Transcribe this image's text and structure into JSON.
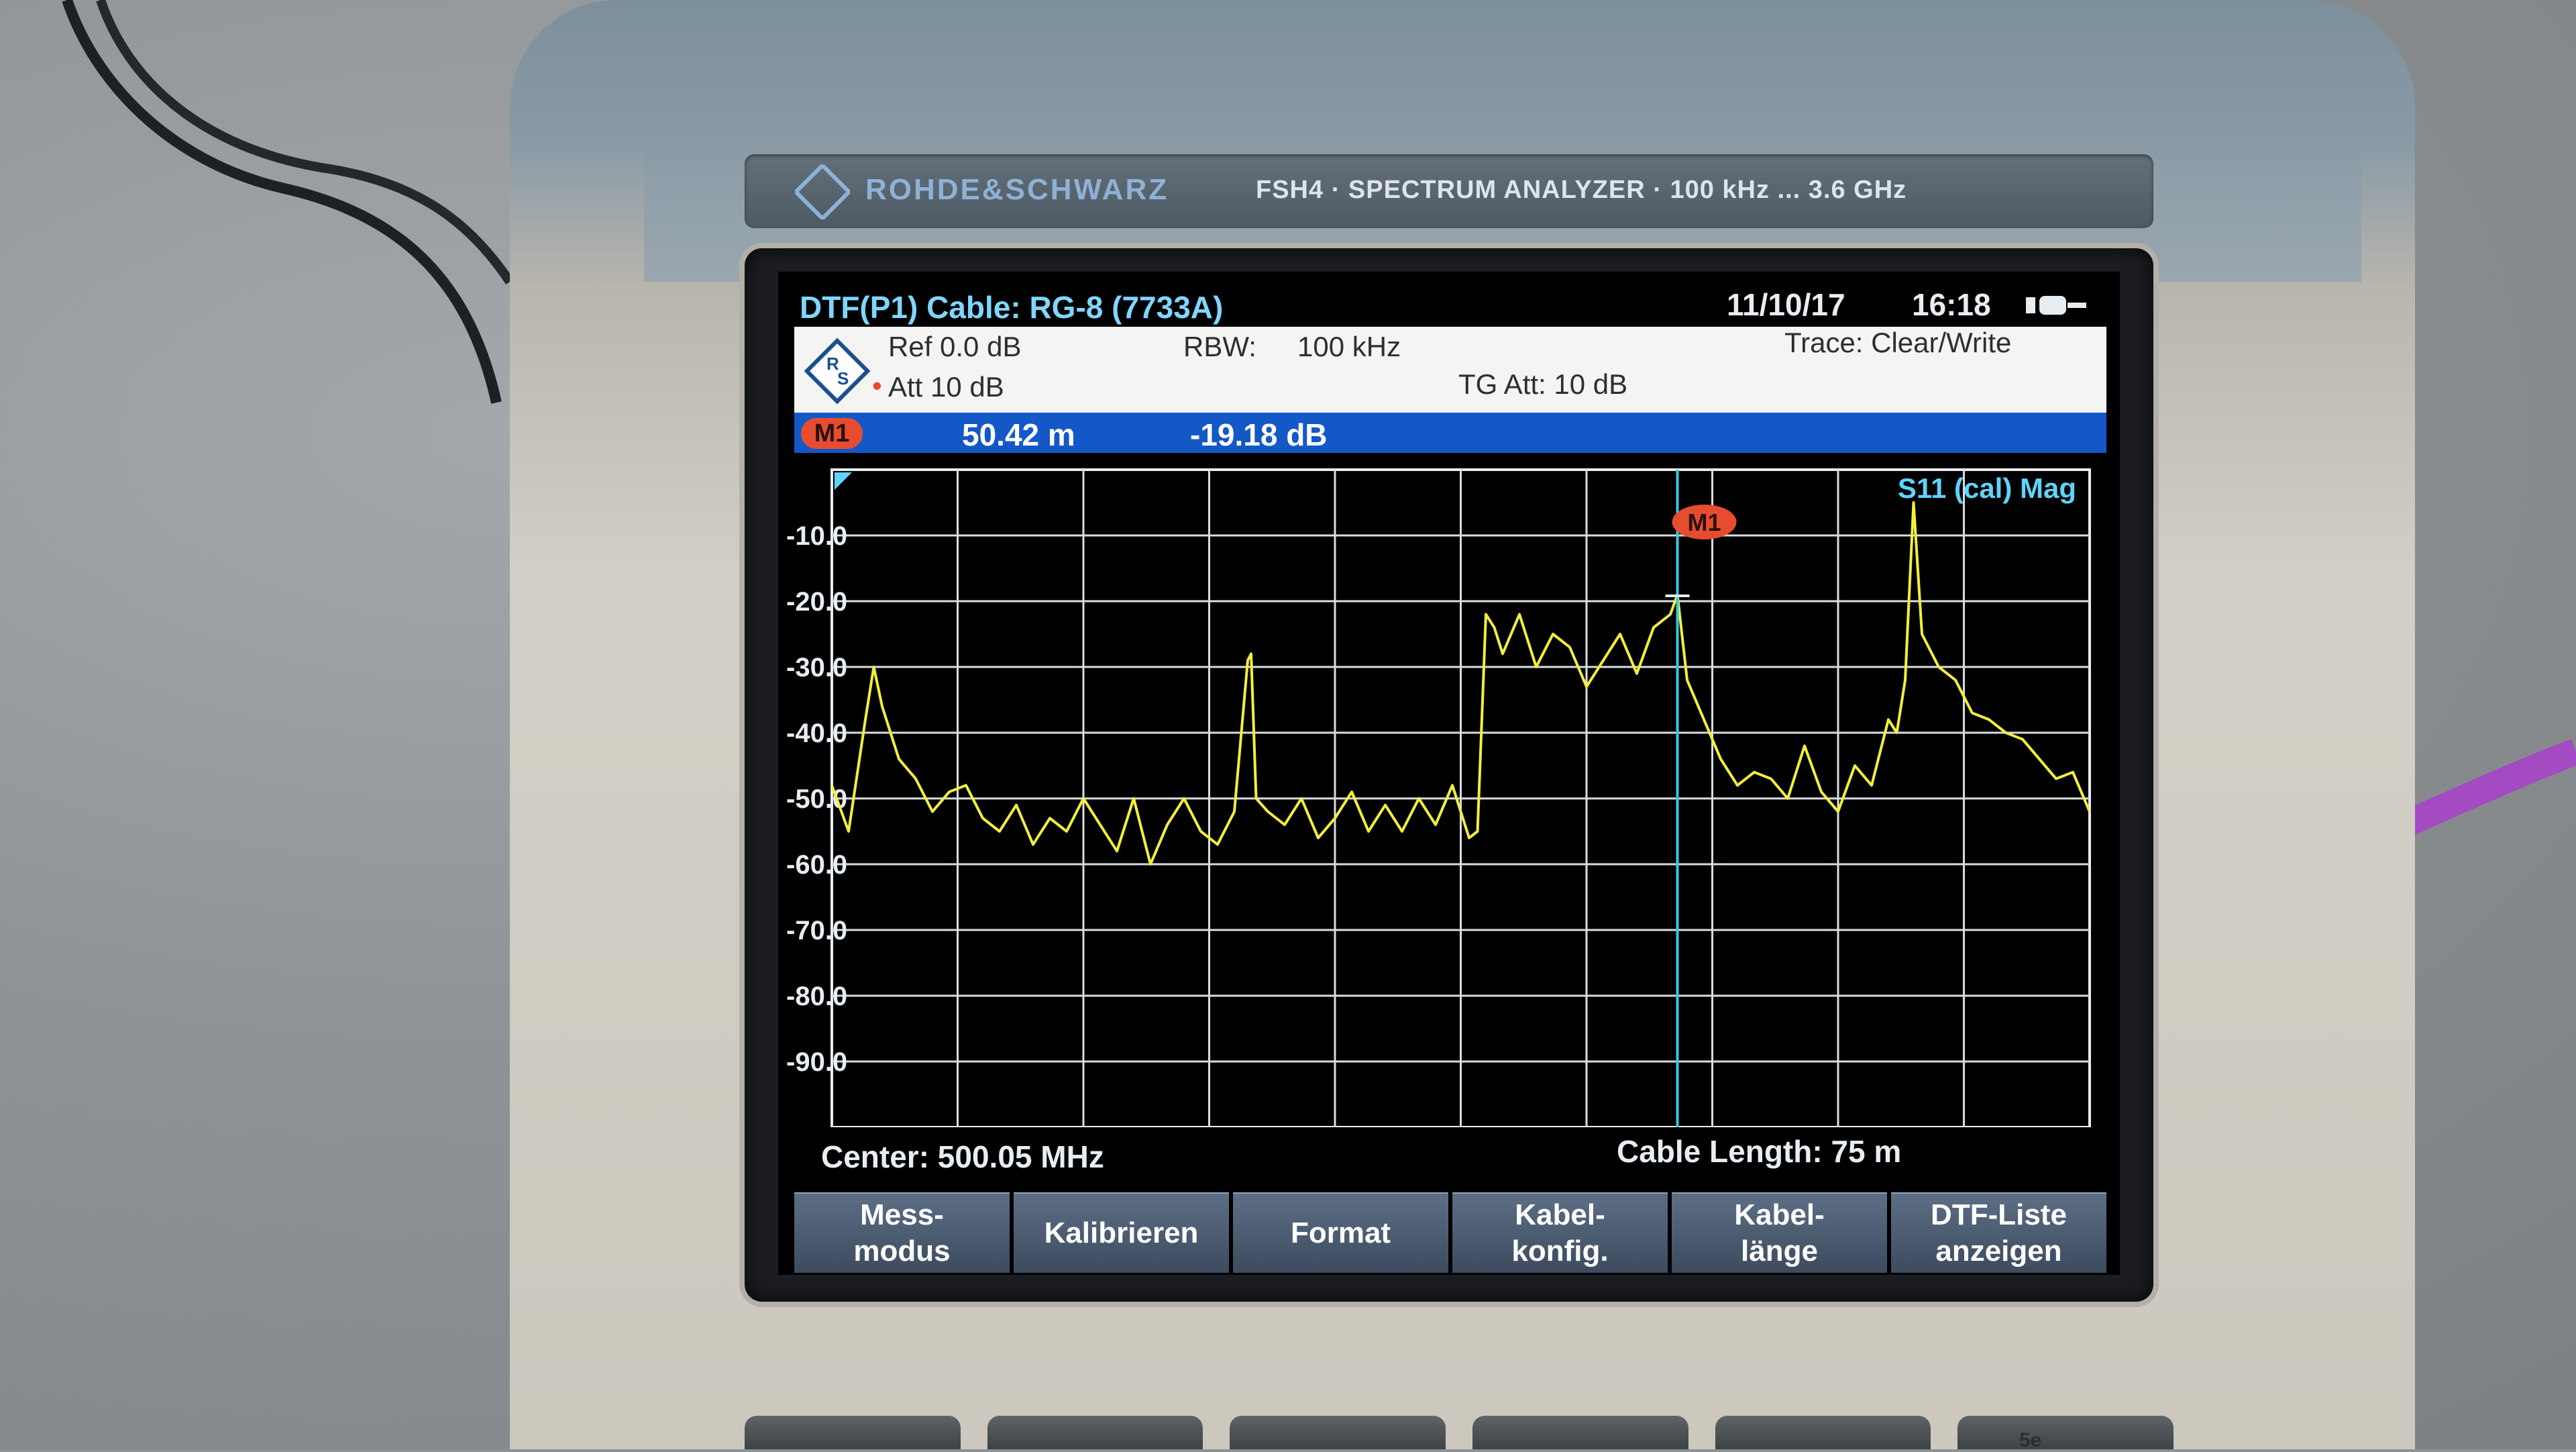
{
  "device": {
    "brand": "ROHDE&SCHWARZ",
    "model": "FSH4 · SPECTRUM ANALYZER · 100 kHz ... 3.6 GHz",
    "bottom_button_label": "5e"
  },
  "screen": {
    "header": {
      "mode": "DTF(P1)  Cable: RG-8 (7733A)",
      "date": "11/10/17",
      "time": "16:18"
    },
    "info": {
      "ref": "Ref  0.0 dB",
      "att": "Att  10 dB",
      "rbw_label": "RBW:",
      "rbw_value": "100 kHz",
      "tg_att": "TG Att:   10 dB",
      "trace": "Trace:  Clear/Write"
    },
    "marker": {
      "badge": "M1",
      "distance": "50.42  m",
      "level": "-19.18   dB"
    },
    "plot": {
      "trace_label": "S11 (cal) Mag",
      "marker_label": "M1"
    },
    "footer": {
      "center": "Center:  500.05 MHz",
      "cable_length": "Cable Length:     75 m"
    },
    "softkeys": [
      "Mess-\nmodus",
      "Kalibrieren",
      "Format",
      "Kabel-\nkonfig.",
      "Kabel-\nlänge",
      "DTF-Liste\nanzeigen"
    ]
  },
  "chart_data": {
    "type": "line",
    "y_ticks": [
      "-10.0",
      "-20.0",
      "-30.0",
      "-40.0",
      "-50.0",
      "-60.0",
      "-70.0",
      "-80.0",
      "-90.0"
    ],
    "ylim": [
      -100,
      0
    ],
    "xlim": [
      0,
      75
    ],
    "grid": true,
    "trace_color": "#f2ef3a",
    "marker": {
      "name": "M1",
      "x": 50.42,
      "y": -19.18
    },
    "series": [
      {
        "x": [
          0,
          1,
          2,
          2.5,
          3,
          4,
          5,
          6,
          7,
          8,
          9,
          10,
          11,
          12,
          13,
          14,
          15,
          16,
          17,
          18,
          19,
          20,
          21,
          22,
          23,
          24,
          24.8,
          25,
          25.3,
          26,
          27,
          28,
          29,
          30,
          31,
          32,
          33,
          34,
          35,
          36,
          37,
          38,
          38.5,
          39,
          39.5,
          40,
          41,
          42,
          43,
          44,
          45,
          46,
          47,
          48,
          49,
          50,
          50.42,
          51,
          52,
          53,
          54,
          55,
          56,
          57,
          58,
          59,
          60,
          61,
          62,
          63,
          63.5,
          64,
          64.5,
          65,
          66,
          67,
          68,
          69,
          70,
          71,
          72,
          73,
          74,
          75
        ],
        "y": [
          -48,
          -55,
          -38,
          -30,
          -36,
          -44,
          -47,
          -52,
          -49,
          -48,
          -53,
          -55,
          -51,
          -57,
          -53,
          -55,
          -50,
          -54,
          -58,
          -50,
          -60,
          -54,
          -50,
          -55,
          -57,
          -52,
          -29,
          -28,
          -50,
          -52,
          -54,
          -50,
          -56,
          -53,
          -49,
          -55,
          -51,
          -55,
          -50,
          -54,
          -48,
          -56,
          -55,
          -22,
          -24,
          -28,
          -22,
          -30,
          -25,
          -27,
          -33,
          -29,
          -25,
          -31,
          -24,
          -22,
          -19,
          -32,
          -38,
          -44,
          -48,
          -46,
          -47,
          -50,
          -42,
          -49,
          -52,
          -45,
          -48,
          -38,
          -40,
          -32,
          -5,
          -25,
          -30,
          -32,
          -37,
          -38,
          -40,
          -41,
          -44,
          -47,
          -46,
          -52
        ]
      }
    ]
  }
}
